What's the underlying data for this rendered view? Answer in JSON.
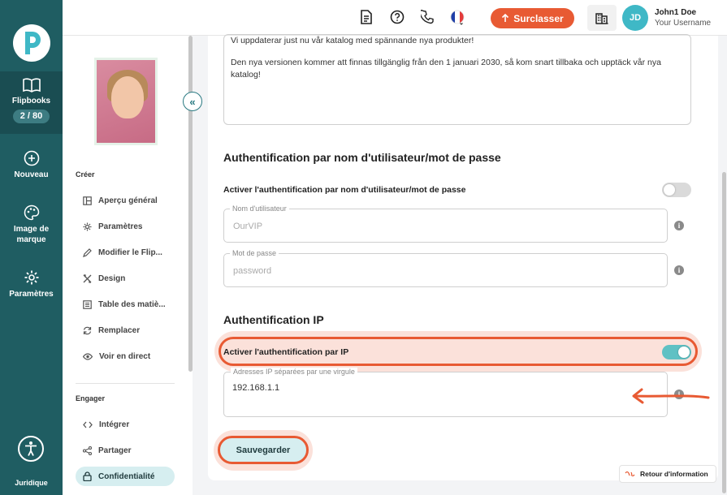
{
  "rail": {
    "items": [
      {
        "label": "Flipbooks",
        "badge": "2 / 80"
      },
      {
        "label": "Nouveau"
      },
      {
        "label": "Image de marque"
      },
      {
        "label": "Paramètres"
      }
    ],
    "bottom_label": "Juridique"
  },
  "topbar": {
    "upgrade_label": "Surclasser",
    "avatar_initials": "JD",
    "user_name": "John1 Doe",
    "user_sub": "Your Username"
  },
  "panel": {
    "section_create": "Créer",
    "nav_create": [
      "Aperçu général",
      "Paramètres",
      "Modifier le Flip...",
      "Design",
      "Table des matiè...",
      "Remplacer",
      "Voir en direct"
    ],
    "section_engage": "Engager",
    "nav_engage": [
      "Intégrer",
      "Partager",
      "Confidentialité"
    ]
  },
  "main": {
    "message_p1": "Vi uppdaterar just nu vår katalog med spännande nya produkter!",
    "message_p2": "Den nya versionen kommer att finnas tillgänglig från den 1 januari 2030, så kom snart tillbaka och upptäck vår nya katalog!",
    "auth_user_title": "Authentification par nom d'utilisateur/mot de passe",
    "auth_user_toggle_label": "Activer l'authentification par nom d'utilisateur/mot de passe",
    "auth_user_toggle_on": false,
    "username_legend": "Nom d'utilisateur",
    "username_placeholder": "OurVIP",
    "password_legend": "Mot de passe",
    "password_placeholder": "password",
    "auth_ip_title": "Authentification IP",
    "auth_ip_toggle_label": "Activer l'authentification par IP",
    "auth_ip_toggle_on": true,
    "ip_legend": "Adresses IP séparées par une virgule",
    "ip_value": "192.168.1.1",
    "save_label": "Sauvegarder"
  },
  "feedback_label": "Retour d'information",
  "colors": {
    "accent": "#e85a33",
    "sidebar": "#1f5d62",
    "teal": "#5fc1c4"
  }
}
